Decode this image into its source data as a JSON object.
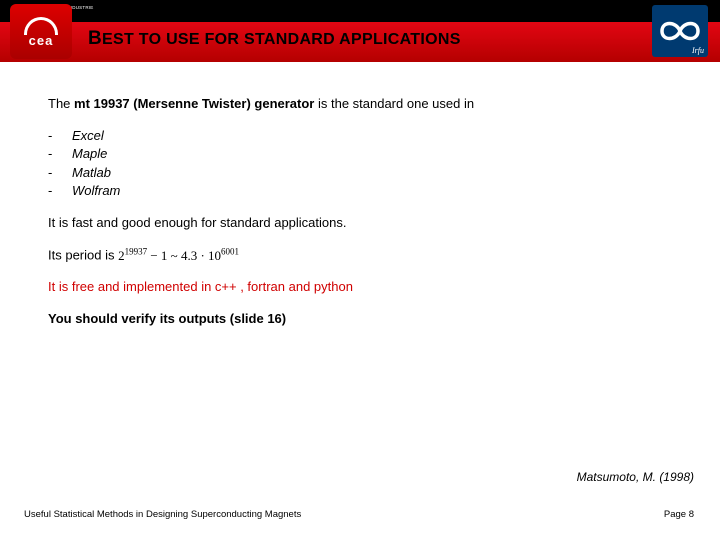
{
  "header": {
    "cea_tag": "DE LA RECHERCHE À L'INDUSTRIE",
    "cea_text": "cea",
    "irfu_text": "Irfu",
    "title_lead": "B",
    "title_rest": "EST TO USE FOR STANDARD APPLICATIONS"
  },
  "body": {
    "intro_pre": "The ",
    "intro_bold": "mt 19937 (Mersenne Twister) generator",
    "intro_post": " is the standard one used in",
    "bullets": [
      "Excel",
      "Maple",
      "Matlab",
      "Wolfram"
    ],
    "fast_line": "It is fast and good enough for standard applications.",
    "period_pre": "Its period is ",
    "period_base1": "2",
    "period_exp1": "19937",
    "period_mid": " − 1 ~ 4.3 · 10",
    "period_exp2": "6001",
    "red_line": "It is free and implemented in c++ , fortran and python",
    "verify_line": "You should verify its outputs (slide 16)"
  },
  "citation": "Matsumoto, M. (1998)",
  "footer": {
    "left": "Useful Statistical Methods in Designing Superconducting Magnets",
    "right": "Page 8"
  }
}
